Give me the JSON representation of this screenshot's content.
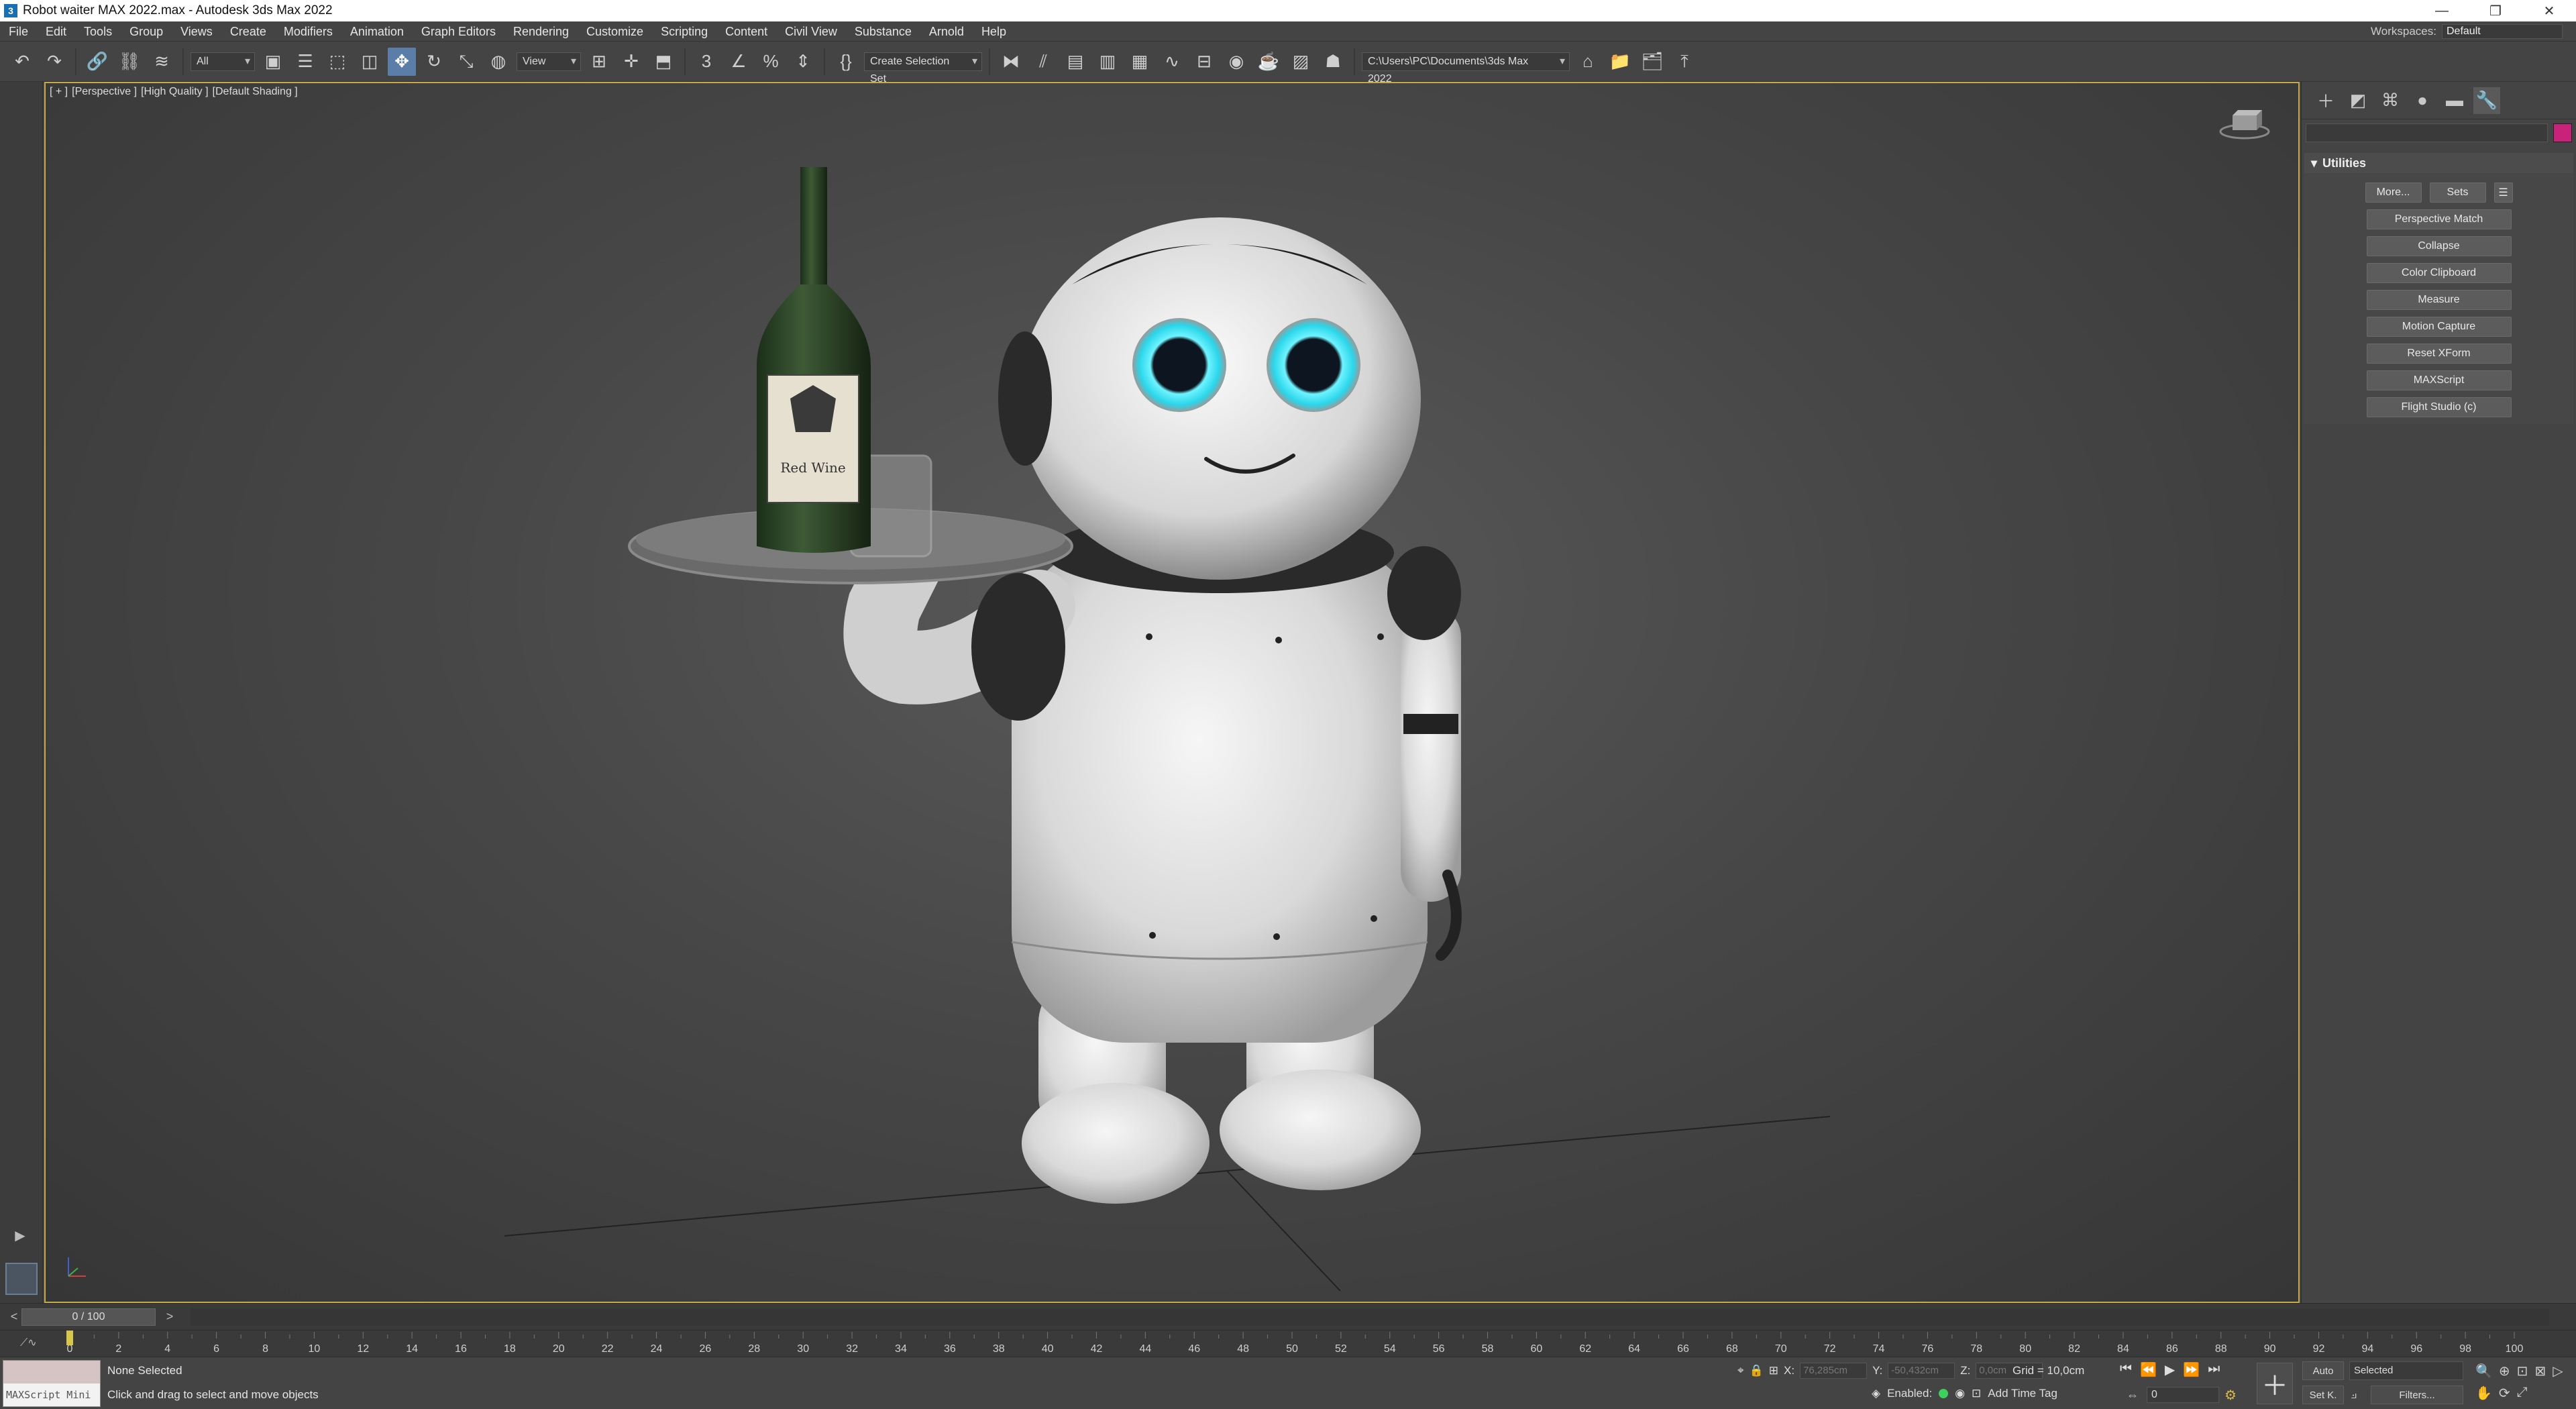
{
  "window": {
    "title": "Robot waiter MAX 2022.max - Autodesk 3ds Max 2022",
    "controls": [
      "—",
      "❐",
      "✕"
    ]
  },
  "menu": {
    "items": [
      "File",
      "Edit",
      "Tools",
      "Group",
      "Views",
      "Create",
      "Modifiers",
      "Animation",
      "Graph Editors",
      "Rendering",
      "Customize",
      "Scripting",
      "Content",
      "Civil View",
      "Substance",
      "Arnold",
      "Help"
    ],
    "workspaces_label": "Workspaces:",
    "workspaces_value": "Default"
  },
  "toolbar": {
    "selection_filter": "All",
    "ref_coord": "View",
    "named_selection": "Create Selection Set",
    "project_path": "C:\\Users\\PC\\Documents\\3ds Max 2022",
    "snap_3d": "3"
  },
  "viewport": {
    "label_plus": "[ + ]",
    "label_view": "[Perspective ]",
    "label_quality": "[High Quality ]",
    "label_shading": "[Default Shading ]",
    "wine_label": "Red Wine"
  },
  "command_panel": {
    "rollout_title": "Utilities",
    "more_btn": "More...",
    "sets_btn": "Sets",
    "utilities": [
      "Perspective Match",
      "Collapse",
      "Color Clipboard",
      "Measure",
      "Motion Capture",
      "Reset XForm",
      "MAXScript",
      "Flight Studio (c)"
    ]
  },
  "timeline": {
    "frame_display": "0 / 100",
    "ticks": [
      0,
      2,
      4,
      6,
      8,
      10,
      12,
      14,
      16,
      18,
      20,
      22,
      24,
      26,
      28,
      30,
      32,
      34,
      36,
      38,
      40,
      42,
      44,
      46,
      48,
      50,
      52,
      54,
      56,
      58,
      60,
      62,
      64,
      66,
      68,
      70,
      72,
      74,
      76,
      78,
      80,
      82,
      84,
      86,
      88,
      90,
      92,
      94,
      96,
      98,
      100
    ]
  },
  "status": {
    "maxscript_mini": "MAXScript Mini",
    "selection": "None Selected",
    "prompt": "Click and drag to select and move objects",
    "x_label": "X:",
    "x_value": "76,285cm",
    "y_label": "Y:",
    "y_value": "-50,432cm",
    "z_label": "Z:",
    "z_value": "0,0cm",
    "grid": "Grid = 10,0cm",
    "enabled_label": "Enabled:",
    "add_time_tag": "Add Time Tag",
    "frame_value": "0",
    "auto_label": "Auto",
    "setk_label": "Set K.",
    "selected_value": "Selected",
    "filters_label": "Filters..."
  }
}
